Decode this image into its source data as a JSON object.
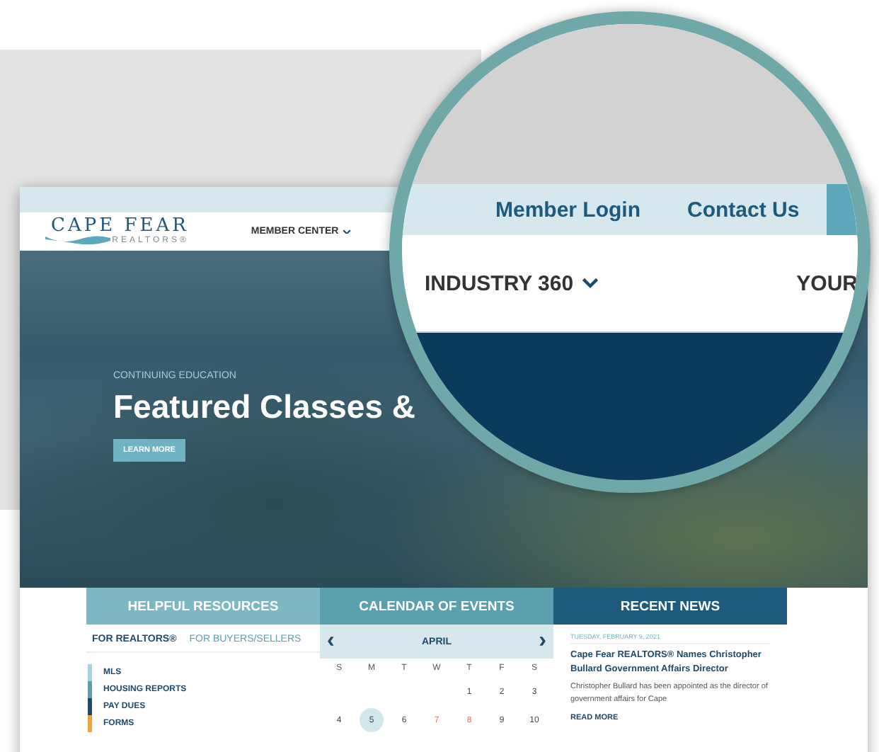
{
  "header": {
    "logo": {
      "title": "CAPE FEAR",
      "subtitle": "REALTORS®"
    },
    "nav": [
      {
        "label": "MEMBER CENTER",
        "dropdown": true
      }
    ]
  },
  "magnifier": {
    "top_links": [
      "Member Login",
      "Contact Us"
    ],
    "nav": [
      {
        "label": "INDUSTRY 360",
        "dropdown": true
      },
      {
        "label": "YOUR",
        "dropdown": false
      }
    ]
  },
  "hero": {
    "eyebrow": "CONTINUING EDUCATION",
    "title": "Featured Classes &",
    "button": "LEARN MORE"
  },
  "panels": [
    {
      "title": "HELPFUL RESOURCES",
      "color": "#7db7c4"
    },
    {
      "title": "CALENDAR OF EVENTS",
      "color": "#5c9fae"
    },
    {
      "title": "RECENT NEWS",
      "color": "#1e5a7e"
    }
  ],
  "resources": {
    "tabs": [
      {
        "label": "FOR REALTORS®",
        "selected": true
      },
      {
        "label": "FOR BUYERS/SELLERS",
        "selected": false
      }
    ],
    "items": [
      {
        "label": "MLS",
        "color": "#a9d3dc"
      },
      {
        "label": "HOUSING REPORTS",
        "color": "#5c9fae"
      },
      {
        "label": "PAY DUES",
        "color": "#1e4a6a"
      },
      {
        "label": "FORMS",
        "color": "#f2a33a"
      }
    ]
  },
  "calendar": {
    "prev": "‹",
    "month": "APRIL",
    "next": "›",
    "weekdays": [
      "S",
      "M",
      "T",
      "W",
      "T",
      "F",
      "S"
    ],
    "weeks": [
      [
        {
          "day": "1",
          "selected": false,
          "marked": false
        },
        {
          "day": "2",
          "selected": false,
          "marked": false
        },
        {
          "day": "3",
          "selected": false,
          "marked": false
        }
      ],
      [
        {
          "day": "4",
          "selected": false,
          "marked": false
        },
        {
          "day": "5",
          "selected": true,
          "marked": false
        },
        {
          "day": "6",
          "selected": false,
          "marked": false
        },
        {
          "day": "7",
          "selected": false,
          "marked": true
        },
        {
          "day": "8",
          "selected": false,
          "marked": true
        },
        {
          "day": "9",
          "selected": false,
          "marked": false
        },
        {
          "day": "10",
          "selected": false,
          "marked": false
        }
      ]
    ]
  },
  "news": {
    "date": "TUESDAY, FEBRUARY 9, 2021",
    "headline": "Cape Fear REALTORS® Names Christopher Bullard Government Affairs Director",
    "summary": "Christopher Bullard has been appointed as the director of government affairs for Cape",
    "link": "READ MORE"
  }
}
